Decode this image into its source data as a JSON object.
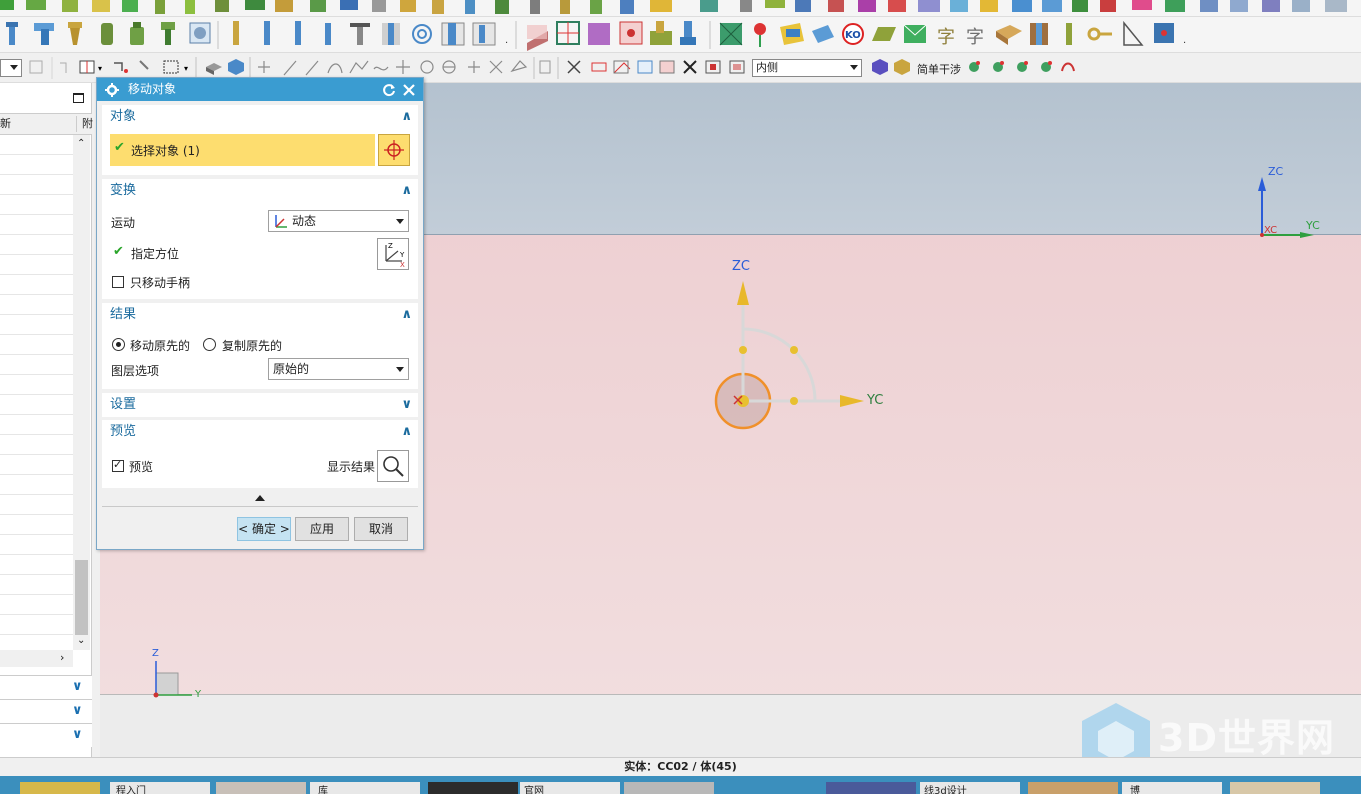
{
  "dialog": {
    "title": "移动对象",
    "object_section": {
      "header": "对象",
      "select_label": "选择对象 (1)"
    },
    "transform_section": {
      "header": "变换",
      "motion_label": "运动",
      "motion_value": "动态",
      "orientation_label": "指定方位",
      "move_handle_only_label": "只移动手柄",
      "move_handle_only_checked": false
    },
    "result_section": {
      "header": "结果",
      "move_original_label": "移动原先的",
      "copy_original_label": "复制原先的",
      "selected": "move_original",
      "layer_option_label": "图层选项",
      "layer_option_value": "原始的"
    },
    "settings_section": {
      "header": "设置"
    },
    "preview_section": {
      "header": "预览",
      "preview_label": "预览",
      "preview_checked": true,
      "show_result_label": "显示结果"
    },
    "buttons": {
      "ok": "< 确定 >",
      "apply": "应用",
      "cancel": "取消"
    }
  },
  "toolbar": {
    "face_dropdown_value": "内侧",
    "simple_interference_label": "简单干涉"
  },
  "navigator": {
    "column_label_left": "新",
    "column_label_right": "附"
  },
  "viewport": {
    "manip_zc": "ZC",
    "manip_yc": "YC",
    "triad_zc": "ZC",
    "triad_yc": "YC",
    "triad_xc": "XC",
    "corner_z": "Z",
    "corner_y": "Y",
    "watermark": "3D世界网"
  },
  "status_bar": {
    "text": "实体：CC02 / 体(45)"
  },
  "taskbar": {
    "items": [
      "程入门",
      "库",
      "官网",
      "线3d设计",
      "博"
    ]
  },
  "colors": {
    "dialog_title": "#3a9cd1",
    "selection_highlight": "#fddd6f",
    "section_header": "#1b6b9e",
    "check_green": "#2aa52a",
    "viewport_top": "#b4c2cf",
    "viewport_pink": "#eccccf"
  }
}
